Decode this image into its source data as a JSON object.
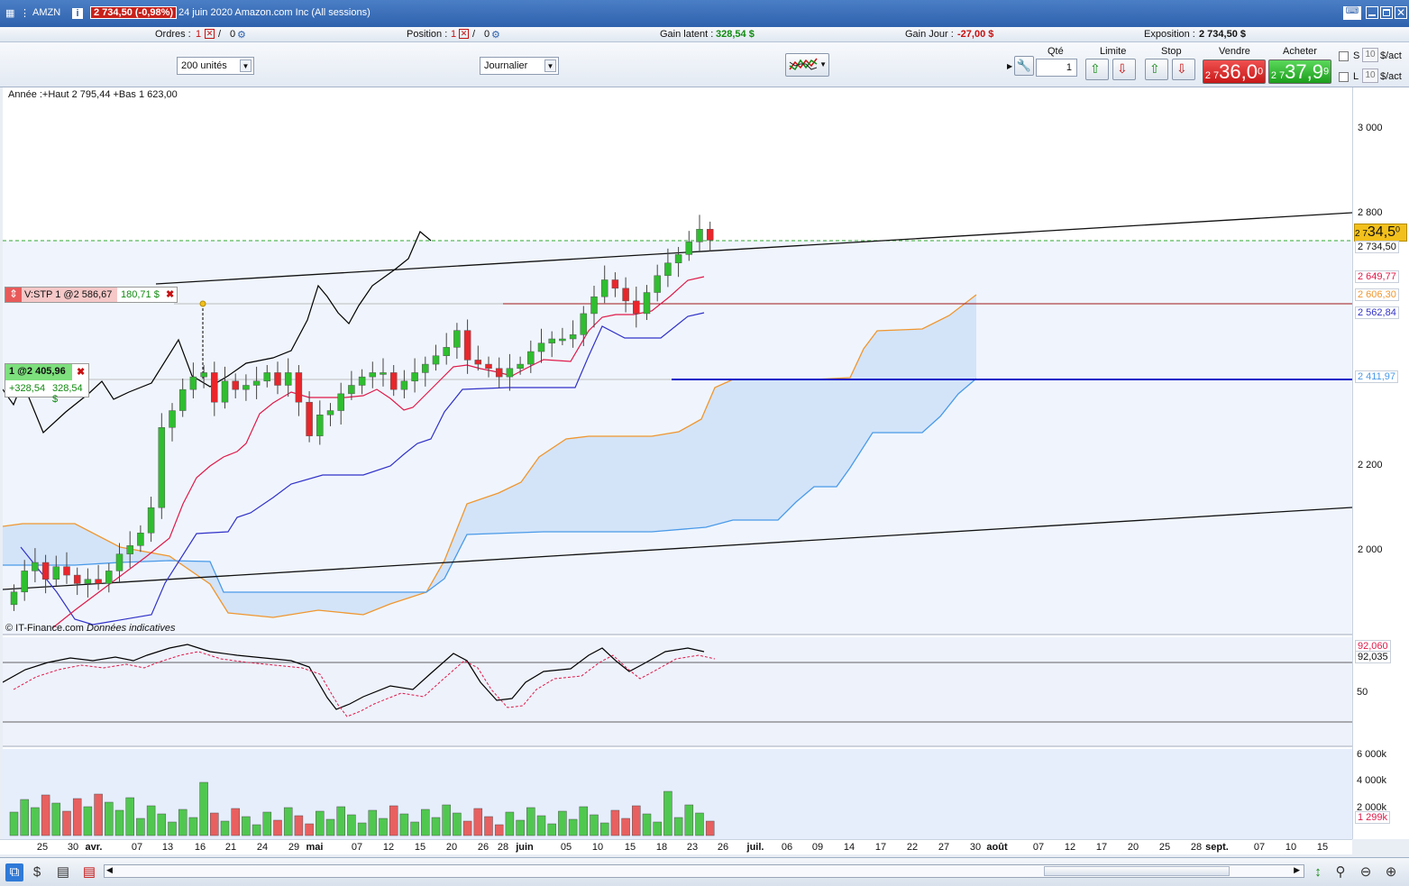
{
  "window": {
    "symbol": "AMZN",
    "price_badge": "2 734,50 (-0,98%)",
    "description": "24 juin 2020 Amazon.com Inc (All sessions)"
  },
  "infobar": {
    "orders_label": "Ordres :",
    "orders_count": "1",
    "orders_zero": "0",
    "position_label": "Position :",
    "position_count": "1",
    "position_zero": "0",
    "gain_latent_label": "Gain latent :",
    "gain_latent_value": "328,54 $",
    "gain_jour_label": "Gain Jour :",
    "gain_jour_value": "-27,00 $",
    "exposition_label": "Exposition :",
    "exposition_value": "2 734,50 $"
  },
  "controls": {
    "units_select": "200 unités",
    "period_select": "Journalier",
    "qty_label": "Qté",
    "qty_value": "1",
    "limit_label": "Limite",
    "stop_label": "Stop",
    "sell_label": "Vendre",
    "sell_small": "2 7",
    "sell_big": "36,0",
    "sell_sup": "0",
    "buy_label": "Acheter",
    "buy_small": "2 7",
    "buy_big": "37,9",
    "buy_sup": "9",
    "s_label": "S",
    "s_value": "10",
    "s_unit": "$/act",
    "l_label": "L",
    "l_value": "10",
    "l_unit": "$/act"
  },
  "chart": {
    "header": "Année :+Haut 2 795,44 +Bas 1 623,00",
    "watermark": "© IT-Finance.com",
    "watermark_note": "Données indicatives",
    "stop_order_label": "V:STP  1 @2 586,67",
    "stop_order_value": "180,71 $",
    "position_label": "1 @2 405,96",
    "position_gain_a": "+328,54",
    "position_gain_b": "328,54 $",
    "current_price_tag_small": "2 7",
    "current_price_tag_big": "34,5",
    "current_price_tag_sup": "0",
    "colors": {
      "up": "#2fbe2f",
      "down": "#e8262b",
      "tenkan": "#e0194a",
      "kijun": "#3232c8",
      "chikou": "#000000",
      "span_a": "#f0962e",
      "span_b": "#4a9ae8",
      "cloud": "#c9ddf7"
    }
  },
  "yaxis": {
    "ticks": [
      "3 000",
      "2 800",
      "2 200",
      "2 000"
    ],
    "labels": [
      "2 734,50",
      "2 649,77",
      "2 606,30",
      "2 562,84",
      "2 411,97"
    ],
    "osc_labels": [
      "92,060",
      "92,035",
      "50"
    ],
    "vol_labels": [
      "6 000k",
      "4 000k",
      "2 000k",
      "1 299k"
    ]
  },
  "xaxis": {
    "labels": [
      "25",
      "30",
      "avr.",
      "07",
      "13",
      "16",
      "21",
      "24",
      "29",
      "mai",
      "07",
      "12",
      "15",
      "20",
      "26",
      "28",
      "juin",
      "05",
      "10",
      "15",
      "18",
      "23",
      "26",
      "juil.",
      "06",
      "09",
      "14",
      "17",
      "22",
      "27",
      "30",
      "août",
      "07",
      "12",
      "17",
      "20",
      "25",
      "28",
      "sept.",
      "07",
      "10",
      "15"
    ]
  },
  "chart_data": {
    "type": "candlestick",
    "title": "AMZN",
    "y_range": [
      1623,
      3100
    ],
    "candles_close": [
      1900,
      1950,
      1970,
      1930,
      1960,
      1940,
      1920,
      1930,
      1920,
      1950,
      1990,
      2010,
      2040,
      2100,
      2290,
      2330,
      2380,
      2410,
      2420,
      2350,
      2400,
      2380,
      2390,
      2400,
      2420,
      2390,
      2420,
      2350,
      2270,
      2320,
      2330,
      2370,
      2390,
      2410,
      2420,
      2420,
      2380,
      2400,
      2420,
      2440,
      2460,
      2480,
      2520,
      2450,
      2440,
      2430,
      2410,
      2430,
      2440,
      2470,
      2490,
      2500,
      2500,
      2510,
      2560,
      2600,
      2640,
      2620,
      2590,
      2560,
      2610,
      2650,
      2680,
      2700,
      2730,
      2760,
      2734
    ]
  }
}
